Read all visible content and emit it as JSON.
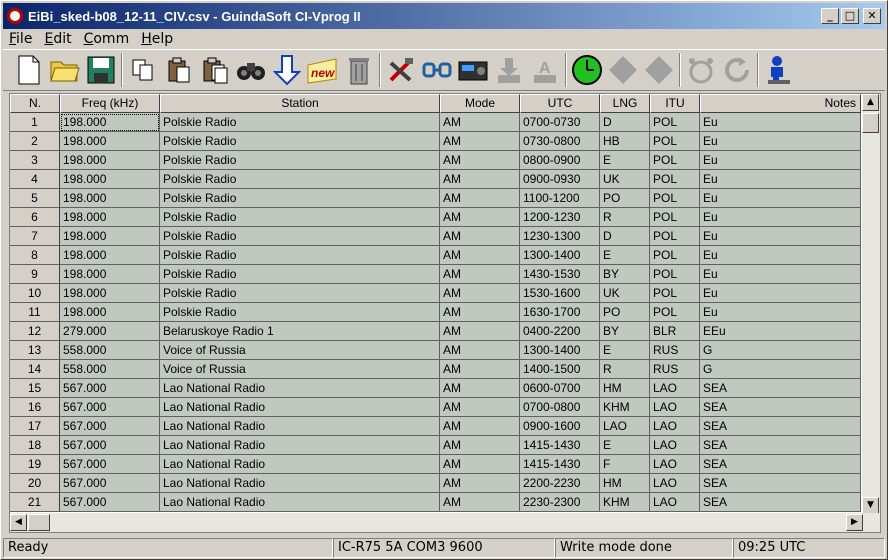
{
  "window": {
    "title": "EiBi_sked-b08_12-11_CIV.csv - GuindaSoft CI-Vprog II"
  },
  "menu": [
    "File",
    "Edit",
    "Comm",
    "Help"
  ],
  "columns": [
    "N.",
    "Freq (kHz)",
    "Station",
    "Mode",
    "UTC",
    "LNG",
    "ITU",
    "Notes"
  ],
  "rows": [
    [
      "1",
      "198.000",
      "Polskie Radio",
      "AM",
      "0700-0730",
      "D",
      "POL",
      "Eu"
    ],
    [
      "2",
      "198.000",
      "Polskie Radio",
      "AM",
      "0730-0800",
      "HB",
      "POL",
      "Eu"
    ],
    [
      "3",
      "198.000",
      "Polskie Radio",
      "AM",
      "0800-0900",
      "E",
      "POL",
      "Eu"
    ],
    [
      "4",
      "198.000",
      "Polskie Radio",
      "AM",
      "0900-0930",
      "UK",
      "POL",
      "Eu"
    ],
    [
      "5",
      "198.000",
      "Polskie Radio",
      "AM",
      "1100-1200",
      "PO",
      "POL",
      "Eu"
    ],
    [
      "6",
      "198.000",
      "Polskie Radio",
      "AM",
      "1200-1230",
      "R",
      "POL",
      "Eu"
    ],
    [
      "7",
      "198.000",
      "Polskie Radio",
      "AM",
      "1230-1300",
      "D",
      "POL",
      "Eu"
    ],
    [
      "8",
      "198.000",
      "Polskie Radio",
      "AM",
      "1300-1400",
      "E",
      "POL",
      "Eu"
    ],
    [
      "9",
      "198.000",
      "Polskie Radio",
      "AM",
      "1430-1530",
      "BY",
      "POL",
      "Eu"
    ],
    [
      "10",
      "198.000",
      "Polskie Radio",
      "AM",
      "1530-1600",
      "UK",
      "POL",
      "Eu"
    ],
    [
      "11",
      "198.000",
      "Polskie Radio",
      "AM",
      "1630-1700",
      "PO",
      "POL",
      "Eu"
    ],
    [
      "12",
      "279.000",
      "Belaruskoye Radio 1",
      "AM",
      "0400-2200",
      "BY",
      "BLR",
      "EEu"
    ],
    [
      "13",
      "558.000",
      "Voice of Russia",
      "AM",
      "1300-1400",
      "E",
      "RUS",
      "G"
    ],
    [
      "14",
      "558.000",
      "Voice of Russia",
      "AM",
      "1400-1500",
      "R",
      "RUS",
      "G"
    ],
    [
      "15",
      "567.000",
      "Lao National Radio",
      "AM",
      "0600-0700",
      "HM",
      "LAO",
      "SEA"
    ],
    [
      "16",
      "567.000",
      "Lao National Radio",
      "AM",
      "0700-0800",
      "KHM",
      "LAO",
      "SEA"
    ],
    [
      "17",
      "567.000",
      "Lao National Radio",
      "AM",
      "0900-1600",
      "LAO",
      "LAO",
      "SEA"
    ],
    [
      "18",
      "567.000",
      "Lao National Radio",
      "AM",
      "1415-1430",
      "E",
      "LAO",
      "SEA"
    ],
    [
      "19",
      "567.000",
      "Lao National Radio",
      "AM",
      "1415-1430",
      "F",
      "LAO",
      "SEA"
    ],
    [
      "20",
      "567.000",
      "Lao National Radio",
      "AM",
      "2200-2230",
      "HM",
      "LAO",
      "SEA"
    ],
    [
      "21",
      "567.000",
      "Lao National Radio",
      "AM",
      "2230-2300",
      "KHM",
      "LAO",
      "SEA"
    ]
  ],
  "status": {
    "ready": "Ready",
    "radio": "IC-R75  5A  COM3  9600",
    "mode": "Write mode done",
    "time": "09:25 UTC"
  },
  "icons": [
    "new-file-icon",
    "open-folder-icon",
    "save-disk-icon",
    "copy-icon",
    "paste-icon",
    "paste-special-icon",
    "find-binoculars-icon",
    "down-arrow-icon",
    "new-badge-icon",
    "trash-icon",
    "tools-icon",
    "connect-icon",
    "radio-icon",
    "download-icon",
    "write-icon",
    "clock-icon",
    "diamond-icon",
    "diamond-icon",
    "alarm-icon",
    "refresh-icon",
    "user-help-icon"
  ],
  "colors": {
    "titlebar": "#0a246a",
    "cell_bg": "#c0c8c0",
    "face": "#d4d0c8"
  }
}
